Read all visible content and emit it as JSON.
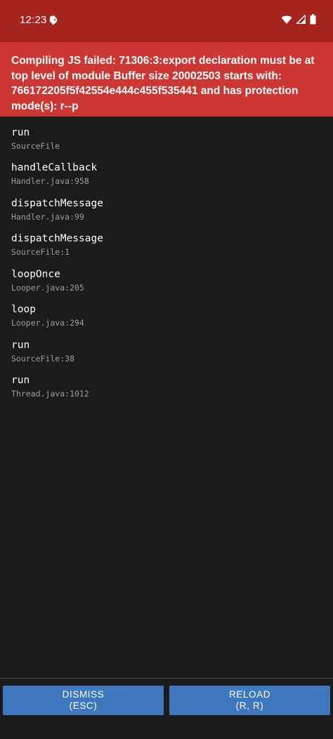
{
  "status_bar": {
    "time": "12:23",
    "notification_icon": "app-notification-icon",
    "icons": [
      "wifi-icon",
      "signal-icon",
      "battery-icon"
    ]
  },
  "error": {
    "message": "Compiling JS failed: 71306:3:export declaration must be at top level of module Buffer size 20002503 starts with: 766172205f5f42554e444c455f535441 and has protection mode(s): r--p"
  },
  "stack": [
    {
      "method": "run",
      "location": "SourceFile"
    },
    {
      "method": "handleCallback",
      "location": "Handler.java:958"
    },
    {
      "method": "dispatchMessage",
      "location": "Handler.java:99"
    },
    {
      "method": "dispatchMessage",
      "location": "SourceFile:1"
    },
    {
      "method": "loopOnce",
      "location": "Looper.java:205"
    },
    {
      "method": "loop",
      "location": "Looper.java:294"
    },
    {
      "method": "run",
      "location": "SourceFile:38"
    },
    {
      "method": "run",
      "location": "Thread.java:1012"
    }
  ],
  "buttons": {
    "dismiss": {
      "label": "DISMISS",
      "shortcut": "(ESC)"
    },
    "reload": {
      "label": "RELOAD",
      "shortcut": "(R, R)"
    }
  },
  "colors": {
    "status_bar": "#a6241e",
    "error_header": "#cc3733",
    "background": "#1b1b1b",
    "button": "#3f77bf",
    "location_text": "#9e9e9e"
  }
}
